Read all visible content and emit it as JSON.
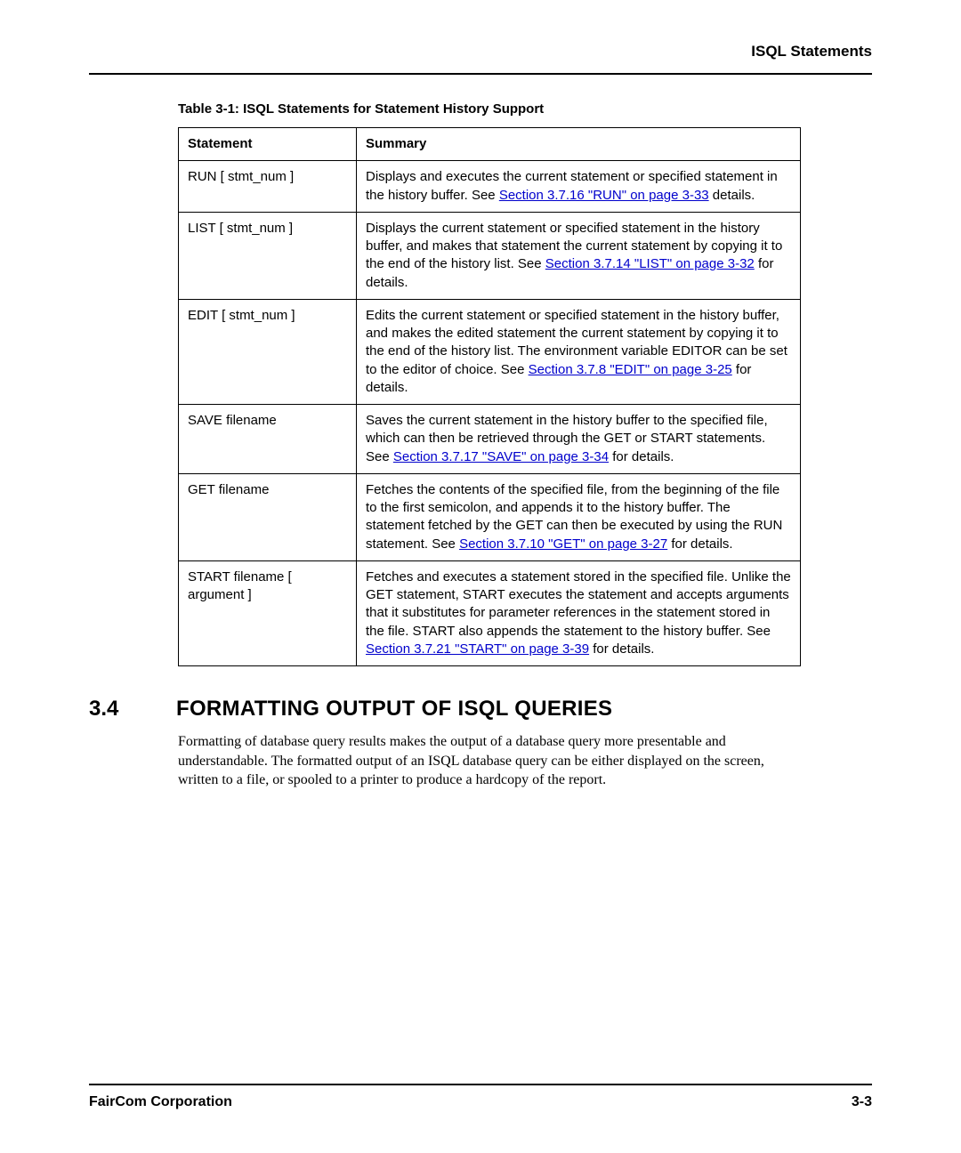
{
  "header": {
    "label": "ISQL Statements"
  },
  "table": {
    "caption": "Table 3-1:  ISQL Statements for Statement History Support",
    "headers": {
      "col1": "Statement",
      "col2": "Summary"
    },
    "rows": [
      {
        "statement": "RUN [ stmt_num ]",
        "pre": "Displays and executes the current statement or specified statement in the history buffer. See ",
        "link": "Section 3.7.16 \"RUN\" on page 3-33",
        "post": " details."
      },
      {
        "statement": "LIST [ stmt_num ]",
        "pre": "Displays the current statement or specified statement in the history buffer, and makes that statement the current statement by copying it to the end of the history list. See ",
        "link": "Section 3.7.14 \"LIST\" on page 3-32",
        "post": " for details."
      },
      {
        "statement": "EDIT [ stmt_num ]",
        "pre": "Edits the current statement or specified statement in the history buffer, and makes the edited statement the current statement by copying it to the end of the history list. The environment variable EDITOR can be set to the editor of choice. See ",
        "link": "Section 3.7.8 \"EDIT\" on page 3-25",
        "post": " for details."
      },
      {
        "statement": "SAVE filename",
        "pre": "Saves the current statement in the history buffer to the specified file, which can then be retrieved through the GET or START statements. See ",
        "link": "Section 3.7.17 \"SAVE\" on page 3-34",
        "post": " for details."
      },
      {
        "statement": "GET filename",
        "pre": "Fetches the contents of the specified file, from the beginning of the file to the first semicolon, and appends it to the history buffer. The statement fetched by the GET can then be executed by using the RUN statement. See ",
        "link": "Section 3.7.10 \"GET\" on page 3-27",
        "post": " for details."
      },
      {
        "statement": "START filename     [ argument   ]",
        "pre": "Fetches and executes a statement stored in the specified file. Unlike the GET statement, START executes the statement and accepts arguments that it substitutes for parameter references in the statement stored in the file. START also appends the statement to the history buffer. See ",
        "link": "Section 3.7.21 \"START\" on page 3-39",
        "post": " for details."
      }
    ]
  },
  "section": {
    "number": "3.4",
    "title": "FORMATTING OUTPUT OF ISQL QUERIES",
    "body": "Formatting of database query results makes the output of a database query more presentable and understandable. The formatted output of an ISQL database query can be either displayed on the screen, written to a file, or spooled to a printer to produce a hardcopy of the report."
  },
  "footer": {
    "left": "FairCom Corporation",
    "right": "3-3"
  }
}
